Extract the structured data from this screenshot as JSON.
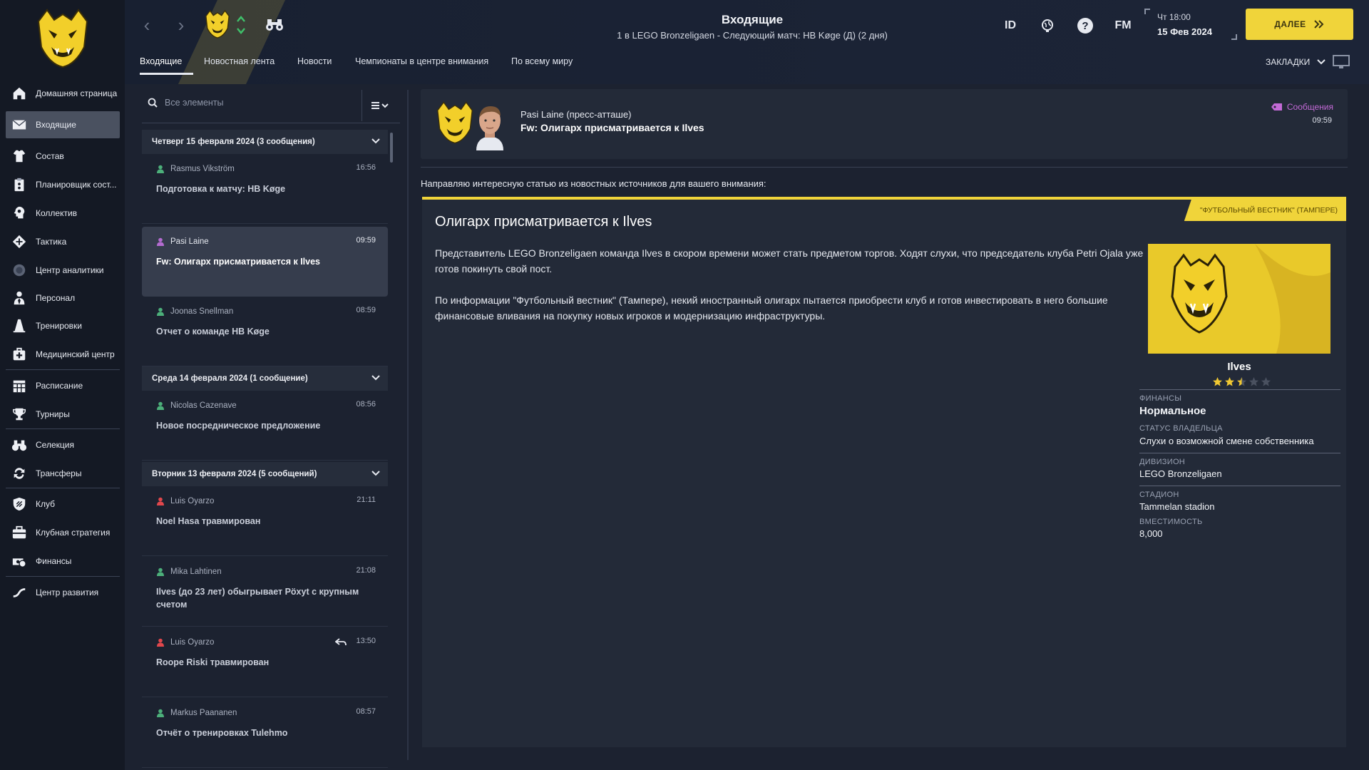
{
  "sidebar": {
    "items": [
      {
        "label": "Домашняя страница",
        "icon": "home-icon"
      },
      {
        "label": "Входящие",
        "icon": "envelope-icon"
      },
      {
        "label": "Состав",
        "icon": "shirt-icon"
      },
      {
        "label": "Планировщик сост...",
        "icon": "clipboard-icon"
      },
      {
        "label": "Коллектив",
        "icon": "head-icon"
      },
      {
        "label": "Тактика",
        "icon": "tactics-icon"
      },
      {
        "label": "Центр аналитики",
        "icon": "analytics-icon"
      },
      {
        "label": "Персонал",
        "icon": "staff-icon"
      },
      {
        "label": "Тренировки",
        "icon": "cone-icon"
      },
      {
        "label": "Медицинский центр",
        "icon": "medical-icon"
      },
      {
        "label": "Расписание",
        "icon": "calendar-icon"
      },
      {
        "label": "Турниры",
        "icon": "trophy-icon"
      },
      {
        "label": "Селекция",
        "icon": "binoculars-icon"
      },
      {
        "label": "Трансферы",
        "icon": "transfer-icon"
      },
      {
        "label": "Клуб",
        "icon": "shield-icon"
      },
      {
        "label": "Клубная стратегия",
        "icon": "briefcase-icon"
      },
      {
        "label": "Финансы",
        "icon": "money-icon"
      },
      {
        "label": "Центр развития",
        "icon": "growth-icon"
      }
    ]
  },
  "header": {
    "title": "Входящие",
    "subtitle": "1 в LEGO Bronzeligaen - Следующий матч: HB Køge (Д) (2 дня)",
    "id_label": "ID",
    "fm_label": "FM",
    "time": "Чт 18:00",
    "date": "15 Фев 2024",
    "continue_label": "ДАЛЕЕ",
    "bookmarks_label": "ЗАКЛАДКИ",
    "tabs": [
      "Входящие",
      "Новостная лента",
      "Новости",
      "Чемпионаты в центре внимания",
      "По всему миру"
    ]
  },
  "list": {
    "search_placeholder": "Все элементы",
    "days": [
      {
        "label": "Четверг 15 февраля 2024 (3 сообщения)"
      },
      {
        "label": "Среда 14 февраля 2024 (1 сообщение)"
      },
      {
        "label": "Вторник 13 февраля 2024 (5 сообщений)"
      }
    ],
    "messages": [
      {
        "sender": "Rasmus Vikström",
        "time": "16:56",
        "subject": "Подготовка к матчу: HB Køge",
        "color": "#4caf7a"
      },
      {
        "sender": "Pasi Laine",
        "time": "09:59",
        "subject": "Fw: Олигарх присматривается к Ilves",
        "color": "#b46cd0"
      },
      {
        "sender": "Joonas Snellman",
        "time": "08:59",
        "subject": "Отчет о команде HB Køge",
        "color": "#4caf7a"
      },
      {
        "sender": "Nicolas Cazenave",
        "time": "08:56",
        "subject": "Новое посредническое предложение",
        "color": "#4caf7a"
      },
      {
        "sender": "Luis Oyarzo",
        "time": "21:11",
        "subject": "Noel Hasa травмирован",
        "color": "#e0474c"
      },
      {
        "sender": "Mika Lahtinen",
        "time": "21:08",
        "subject": "Ilves (до 23 лет) обыгрывает Pöxyt с крупным счетом",
        "color": "#4caf7a"
      },
      {
        "sender": "Luis Oyarzo",
        "time": "13:50",
        "subject": "Roope Riski травмирован",
        "color": "#e0474c"
      },
      {
        "sender": "Markus Paananen",
        "time": "08:57",
        "subject": "Отчёт о тренировках Tulehmo",
        "color": "#4caf7a"
      }
    ]
  },
  "reading": {
    "sender": "Pasi Laine  (пресс-атташе)",
    "subject": "Fw: Олигарх присматривается к Ilves",
    "tag": "Сообщения",
    "time": "09:59",
    "intro": "Направляю интересную статью из новостных источников для вашего внимания:",
    "article": {
      "source": "\"ФУТБОЛЬНЫЙ ВЕСТНИК\" (ТАМПЕРЕ)",
      "title": "Олигарх присматривается к Ilves",
      "p1": "Представитель LEGO Bronzeligaen команда Ilves в скором времени может стать предметом торгов. Ходят слухи, что председатель клуба Petri Ojala уже готов покинуть свой пост.",
      "p2": "По информации \"Футбольный вестник\" (Тампере), некий иностранный олигарх пытается приобрести клуб и готов инвестировать в него большие финансовые вливания на покупку новых игроков и модернизацию инфраструктуры."
    },
    "club": {
      "name": "Ilves",
      "rating_stars": 2.5,
      "finance_label": "ФИНАНСЫ",
      "finance_value": "Нормальное",
      "owner_label": "СТАТУС ВЛАДЕЛЬЦА",
      "owner_value": "Слухи о возможной смене собственника",
      "division_label": "ДИВИЗИОН",
      "division_value": "LEGO Bronzeligaen",
      "stadium_label": "СТАДИОН",
      "stadium_value": "Tammelan stadion",
      "capacity_label": "ВМЕСТИМОСТЬ",
      "capacity_value": "8,000"
    }
  },
  "colors": {
    "accent": "#f0d43a",
    "sidebar_bg": "#141924",
    "panel_bg": "#232a38",
    "message_tag": "#c36ad6"
  }
}
